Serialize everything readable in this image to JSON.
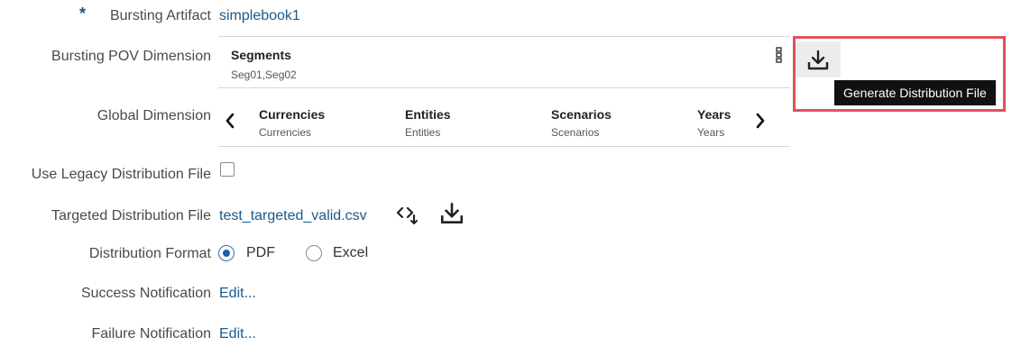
{
  "bursting_artifact": {
    "required_marker": "*",
    "label": "Bursting Artifact",
    "value": "simplebook1"
  },
  "bursting_pov": {
    "label": "Bursting POV Dimension",
    "dimension": "Segments",
    "members": "Seg01,Seg02",
    "menu_icon": "kebab-menu-icon",
    "generate_icon": "download-icon",
    "generate_tooltip": "Generate Distribution File"
  },
  "global_dimension": {
    "label": "Global Dimension",
    "prev_icon": "chevron-left-icon",
    "next_icon": "chevron-right-icon",
    "items": [
      {
        "title": "Currencies",
        "sub": "Currencies"
      },
      {
        "title": "Entities",
        "sub": "Entities"
      },
      {
        "title": "Scenarios",
        "sub": "Scenarios"
      },
      {
        "title": "Years",
        "sub": "Years"
      }
    ]
  },
  "legacy": {
    "label": "Use Legacy Distribution File",
    "checked": false
  },
  "targeted": {
    "label": "Targeted Distribution File",
    "value": "test_targeted_valid.csv",
    "select_icon": "select-file-icon",
    "download_icon": "download-icon"
  },
  "format": {
    "label": "Distribution Format",
    "options": [
      {
        "label": "PDF",
        "selected": true
      },
      {
        "label": "Excel",
        "selected": false
      }
    ]
  },
  "success": {
    "label": "Success Notification",
    "action": "Edit..."
  },
  "failure": {
    "label": "Failure Notification",
    "action": "Edit..."
  },
  "colors": {
    "link": "#1a5a8a",
    "highlight": "#e0525a",
    "radio_selected": "#1f5fa8",
    "tooltip_bg": "#111111"
  }
}
